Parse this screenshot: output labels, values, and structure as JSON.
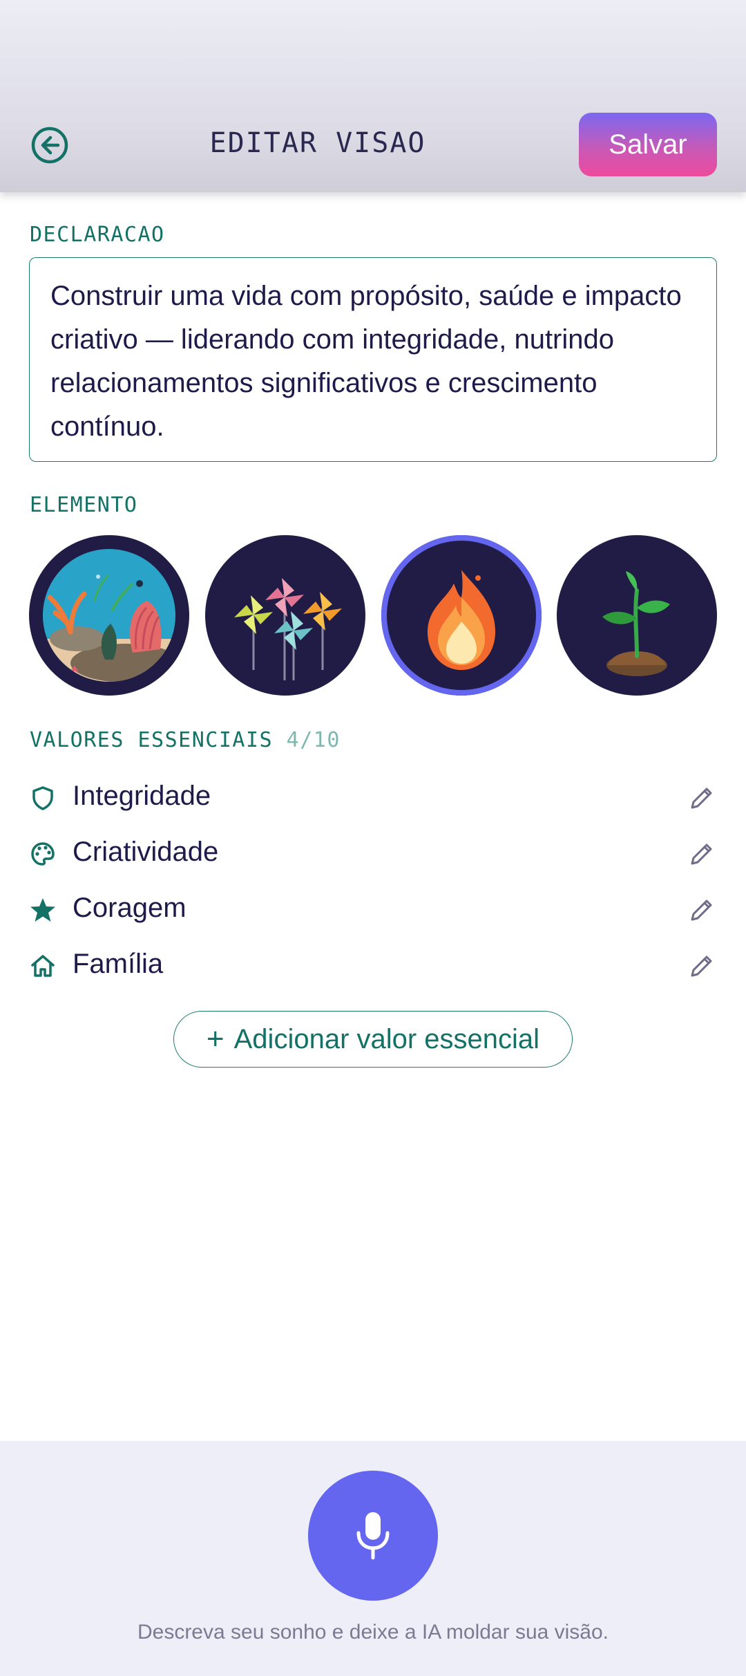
{
  "header": {
    "title": "EDITAR VISAO",
    "save_label": "Salvar",
    "back_icon": "arrow-left-circle-icon"
  },
  "statement": {
    "label": "DECLARACAO",
    "text": "Construir uma vida com propósito, saúde e impacto criativo — liderando com integridade, nutrindo relacionamentos significativos e crescimento contínuo."
  },
  "element": {
    "label": "ELEMENTO",
    "options": [
      {
        "icon": "coral-reef-icon",
        "selected": false
      },
      {
        "icon": "pinwheels-icon",
        "selected": false
      },
      {
        "icon": "flame-icon",
        "selected": true
      },
      {
        "icon": "sprout-icon",
        "selected": false
      }
    ],
    "selected_color": "#6466f0"
  },
  "values": {
    "label": "VALORES ESSENCIAIS",
    "count": "4/10",
    "items": [
      {
        "label": "Integridade",
        "icon": "shield-icon"
      },
      {
        "label": "Criatividade",
        "icon": "palette-icon"
      },
      {
        "label": "Coragem",
        "icon": "star-icon"
      },
      {
        "label": "Família",
        "icon": "home-icon"
      }
    ],
    "add_label": "Adicionar valor essencial"
  },
  "voice": {
    "hint": "Descreva seu sonho e deixe a IA moldar sua visão.",
    "icon": "microphone-icon"
  },
  "colors": {
    "accent_teal": "#137166",
    "accent_purple": "#6466f0",
    "text_dark": "#1e1b4b",
    "save_gradient_start": "#7b68f0",
    "save_gradient_end": "#ee4a9c"
  }
}
